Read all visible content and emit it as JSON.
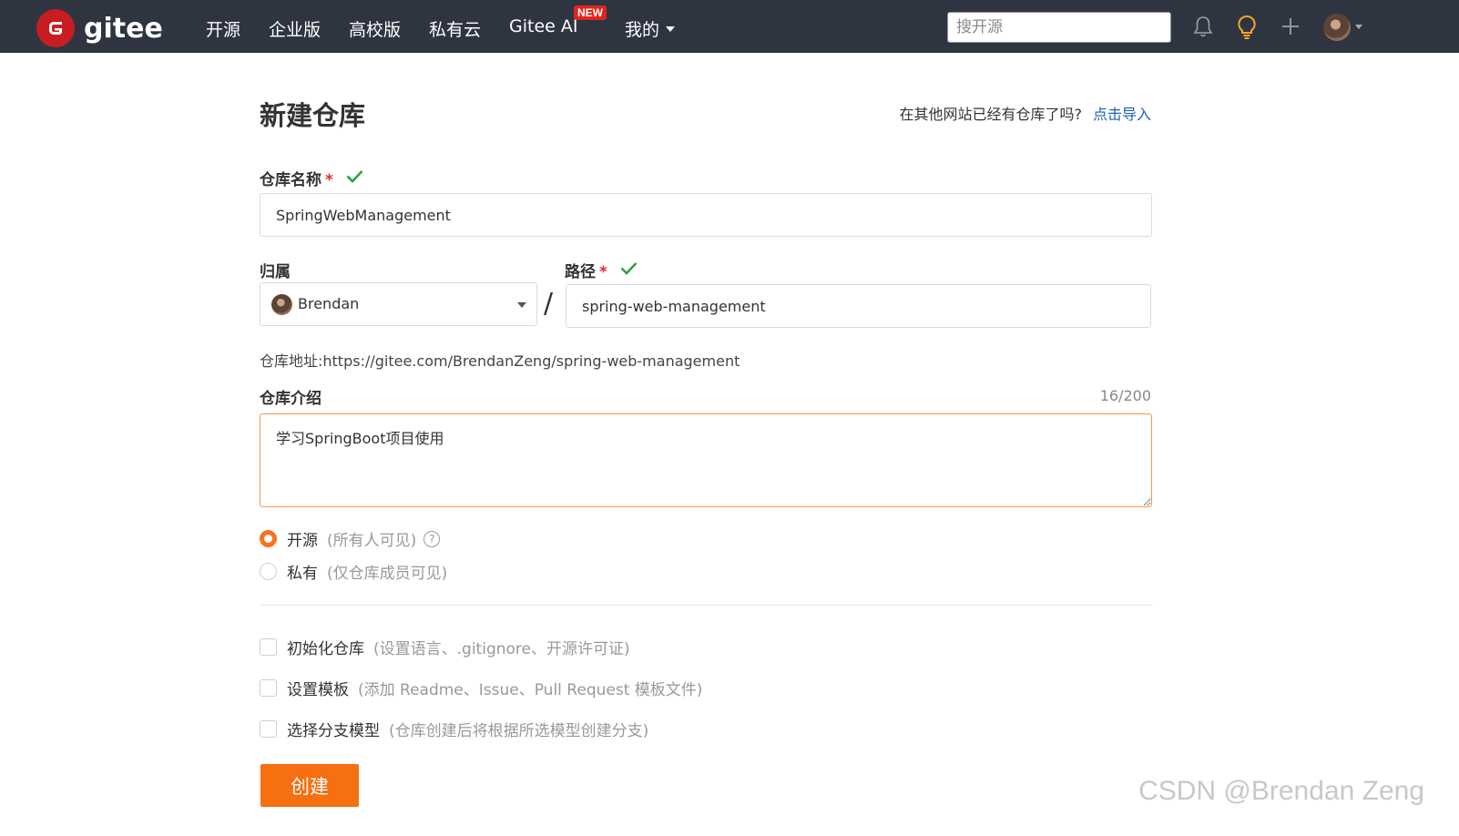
{
  "nav": {
    "brand": "gitee",
    "items": [
      "开源",
      "企业版",
      "高校版",
      "私有云",
      "Gitee AI",
      "我的"
    ],
    "new_badge": "NEW",
    "search_placeholder": "搜开源",
    "accent": "#c71d23",
    "bar_color": "#2f3441"
  },
  "page": {
    "title": "新建仓库",
    "import_prompt": "在其他网站已经有仓库了吗?",
    "import_link": "点击导入"
  },
  "form": {
    "name_label": "仓库名称",
    "required_mark": "*",
    "name_value": "SpringWebManagement",
    "owner_label": "归属",
    "owner_value": "Brendan",
    "path_label": "路径",
    "path_separator": "/",
    "path_value": "spring-web-management",
    "repo_url_text": "仓库地址:https://gitee.com/BrendanZeng/spring-web-management",
    "desc_label": "仓库介绍",
    "desc_counter": "16/200",
    "desc_value": "学习SpringBoot项目使用",
    "visibility": [
      {
        "label": "开源",
        "hint": "(所有人可见)",
        "selected": true,
        "help": "?"
      },
      {
        "label": "私有",
        "hint": "(仅仓库成员可见)",
        "selected": false
      }
    ],
    "options": [
      {
        "label": "初始化仓库",
        "hint": "(设置语言、.gitignore、开源许可证)",
        "checked": false
      },
      {
        "label": "设置模板",
        "hint": "(添加 Readme、Issue、Pull Request 模板文件)",
        "checked": false
      },
      {
        "label": "选择分支模型",
        "hint": "(仓库创建后将根据所选模型创建分支)",
        "checked": false
      }
    ],
    "submit_label": "创建",
    "submit_color": "#f66f11",
    "valid_color": "#2ea043"
  },
  "watermark": "CSDN @Brendan Zeng"
}
